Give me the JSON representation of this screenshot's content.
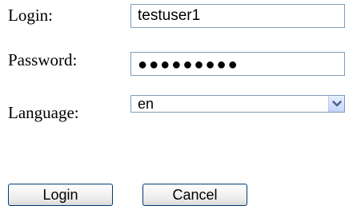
{
  "form": {
    "login_label": "Login:",
    "login_value": "testuser1",
    "password_label": "Password:",
    "password_value": "●●●●●●●●●",
    "language_label": "Language:",
    "language_value": "en",
    "language_options": [
      "en"
    ]
  },
  "buttons": {
    "login_label": "Login",
    "cancel_label": "Cancel"
  },
  "colors": {
    "field_border": "#7f9db9",
    "button_border": "#003c74",
    "select_arrow": "#4d6185"
  },
  "icons": {
    "select_arrow": "chevron-down-icon"
  }
}
